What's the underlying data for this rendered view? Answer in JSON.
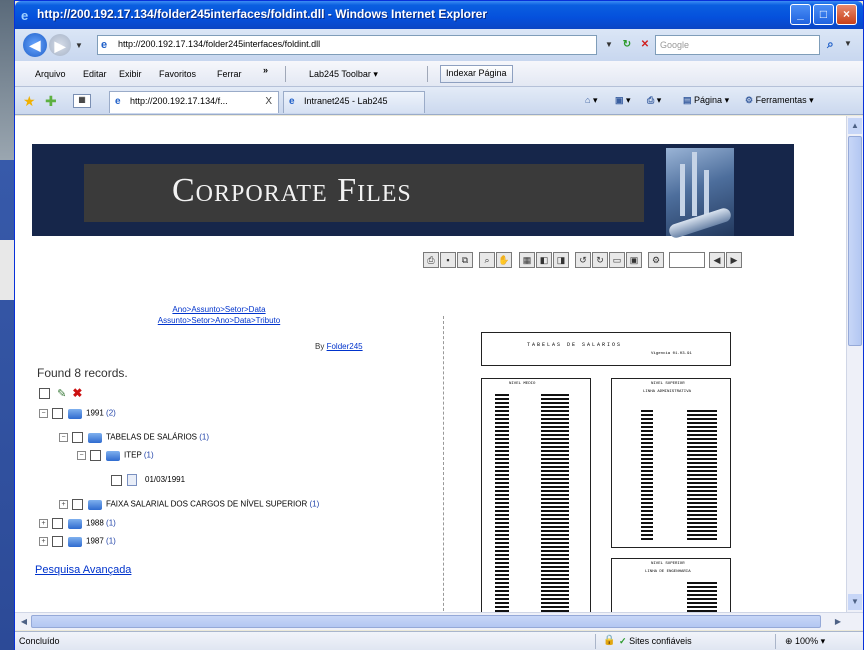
{
  "window": {
    "title": "http://200.192.17.134/folder245interfaces/foldint.dll - Windows Internet Explorer"
  },
  "address": {
    "url": "http://200.192.17.134/folder245interfaces/foldint.dll",
    "search_placeholder": "Google"
  },
  "menu": {
    "items": [
      "Arquivo",
      "Editar",
      "Exibir",
      "Favoritos",
      "Ferrar"
    ],
    "more": "»",
    "lab_toolbar": "Lab245 Toolbar",
    "index_button": "Indexar Página"
  },
  "tabs": [
    {
      "label": "http://200.192.17.134/f...",
      "close": "X"
    },
    {
      "label": "Intranet245 - Lab245"
    }
  ],
  "commands": {
    "page": "Página",
    "tools": "Ferramentas"
  },
  "banner": {
    "title": "Corporate Files"
  },
  "links": {
    "line1": "Ano>Assunto>Setor>Data",
    "line2": "Assunto>Setor>Ano>Data>Tributo"
  },
  "by": {
    "prefix": "By",
    "name": "Folder245"
  },
  "found": "Found 8 records.",
  "tree": [
    {
      "label": "1991",
      "count": "(2)"
    },
    {
      "label": "TABELAS DE SALÁRIOS",
      "count": "(1)"
    },
    {
      "label": "ITEP",
      "count": "(1)"
    },
    {
      "label": "01/03/1991",
      "count": ""
    },
    {
      "label": "FAIXA SALARIAL DOS CARGOS DE NÍVEL SUPERIOR",
      "count": "(1)"
    },
    {
      "label": "1988",
      "count": "(1)"
    },
    {
      "label": "1987",
      "count": "(1)"
    }
  ],
  "advanced_search": "Pesquisa Avançada",
  "document": {
    "header": "TABELAS DE SALARIOS",
    "subheader": "Vigencia 01.03.91",
    "col_left": "NIVEL MEDIO",
    "col_right_1": "NIVEL SUPERIOR",
    "col_right_2": "LINHA ADMINISTRATIVA",
    "col_right_3": "NIVEL SUPERIOR",
    "col_right_4": "LINHA DE ENGENHARIA"
  },
  "status": {
    "text": "Concluído",
    "zone": "Sites confiáveis",
    "zoom": "100%"
  },
  "colors": {
    "titlebar": "#0550dc",
    "banner_bg": "#16264a",
    "link": "#0033cc"
  }
}
